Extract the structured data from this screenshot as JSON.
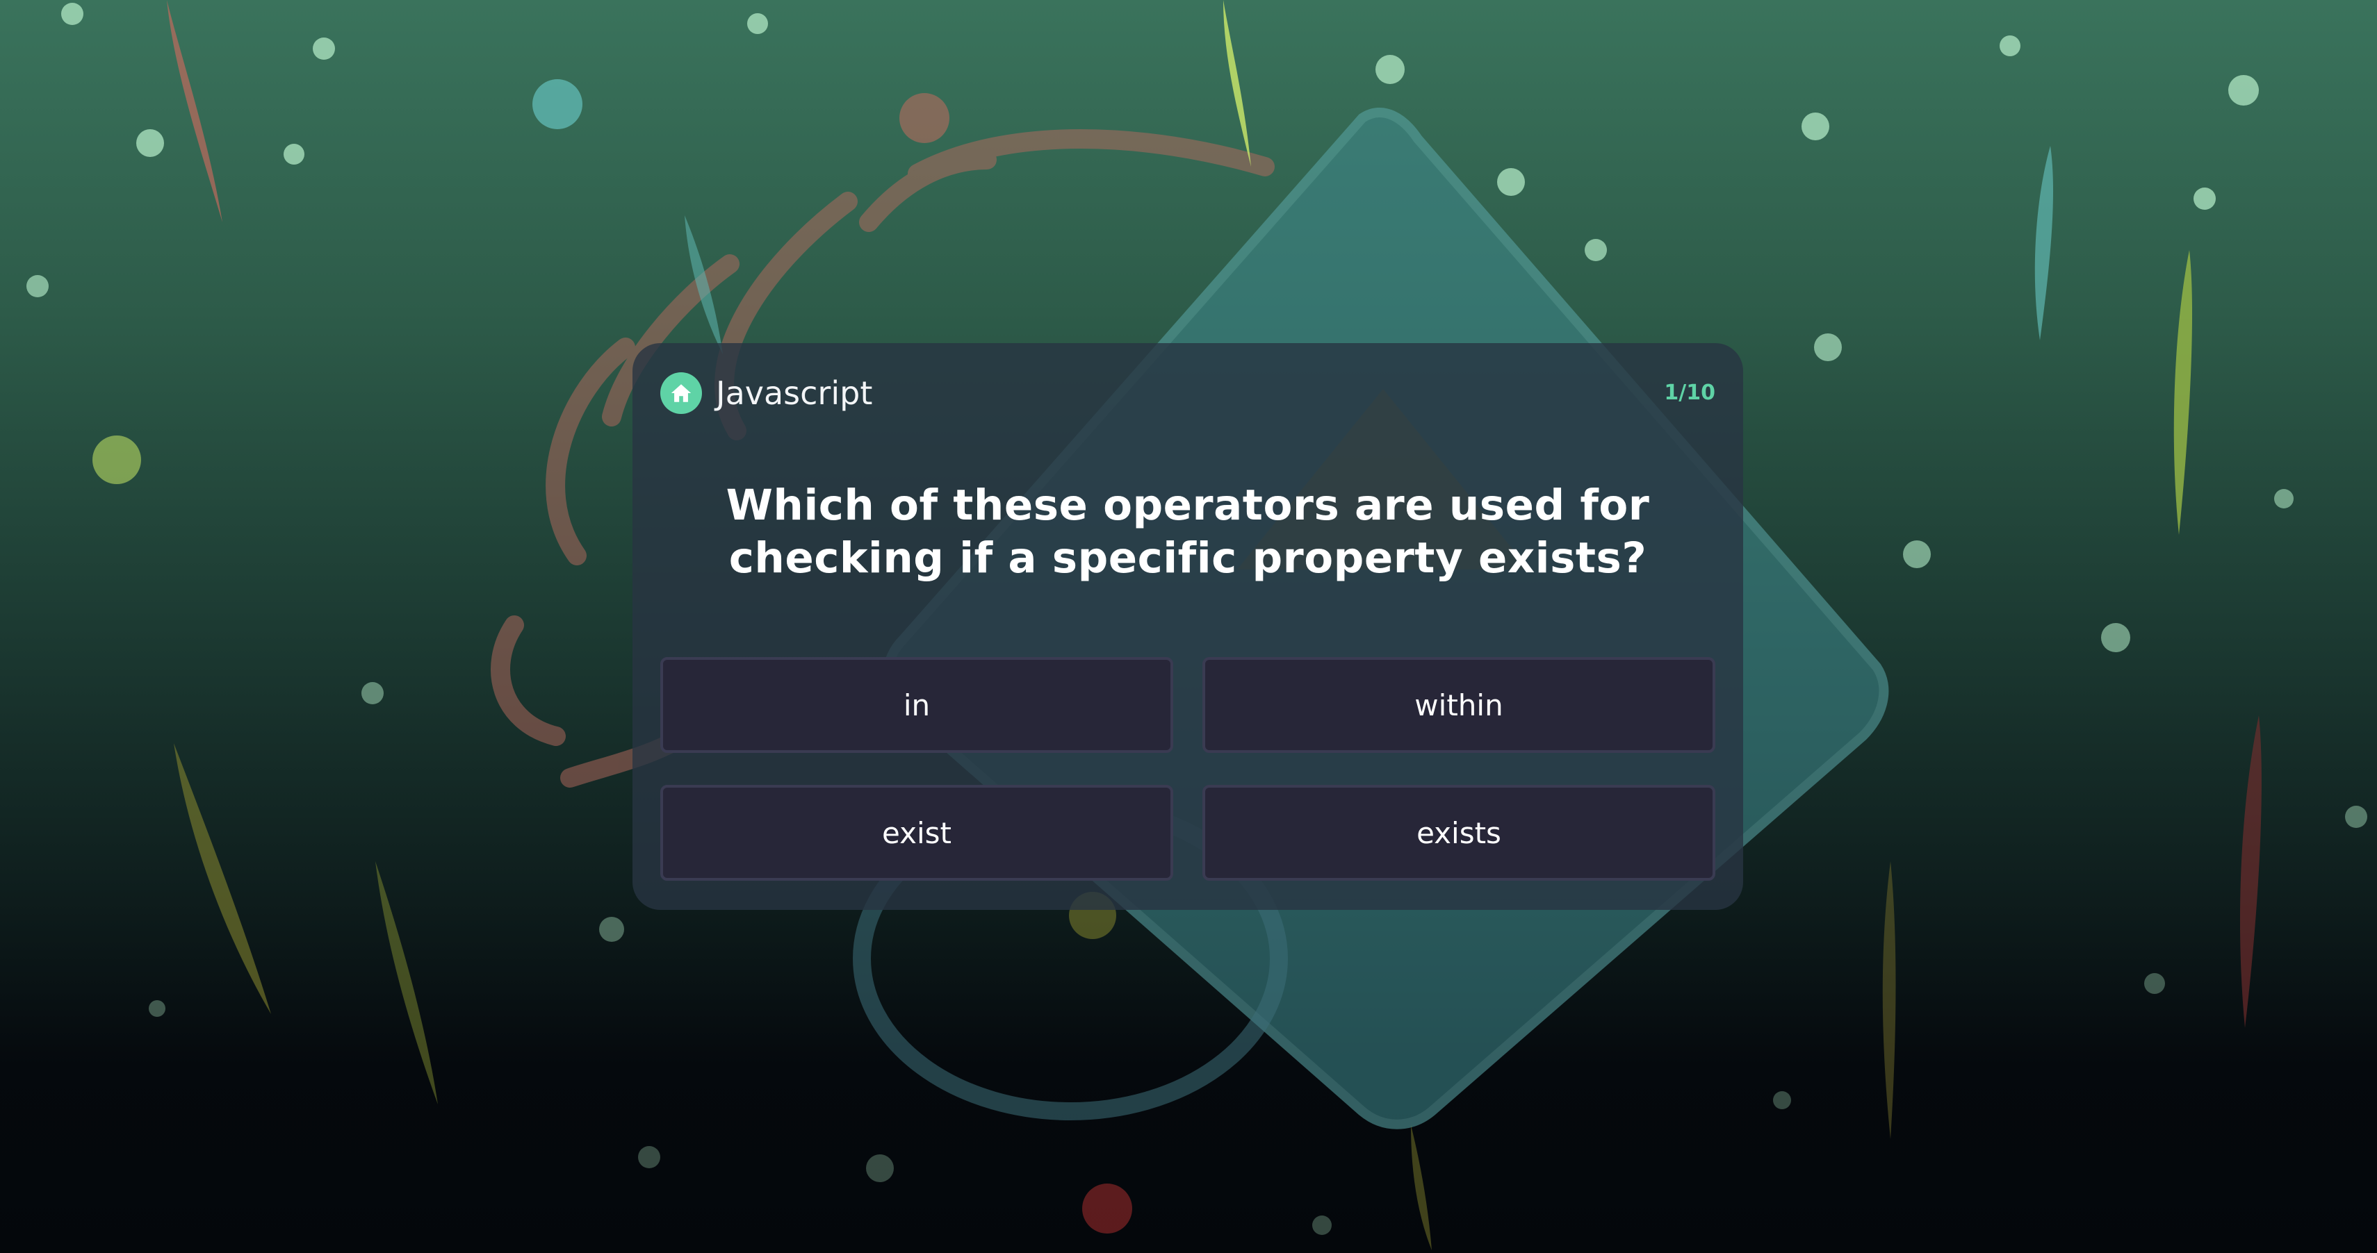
{
  "quiz": {
    "category": "Javascript",
    "progress": "1/10",
    "question": "Which of these operators are used for checking if a specific property exists?",
    "answers": [
      {
        "label": "in"
      },
      {
        "label": "within"
      },
      {
        "label": "exist"
      },
      {
        "label": "exists"
      }
    ]
  },
  "icons": {
    "home": "home-icon"
  },
  "colors": {
    "accent": "#5fd3a6",
    "card": "#283442",
    "answer_bg": "#272638",
    "answer_border": "#3a3b52",
    "bg_top": "#3a735c",
    "bg_bottom": "#04070b"
  }
}
